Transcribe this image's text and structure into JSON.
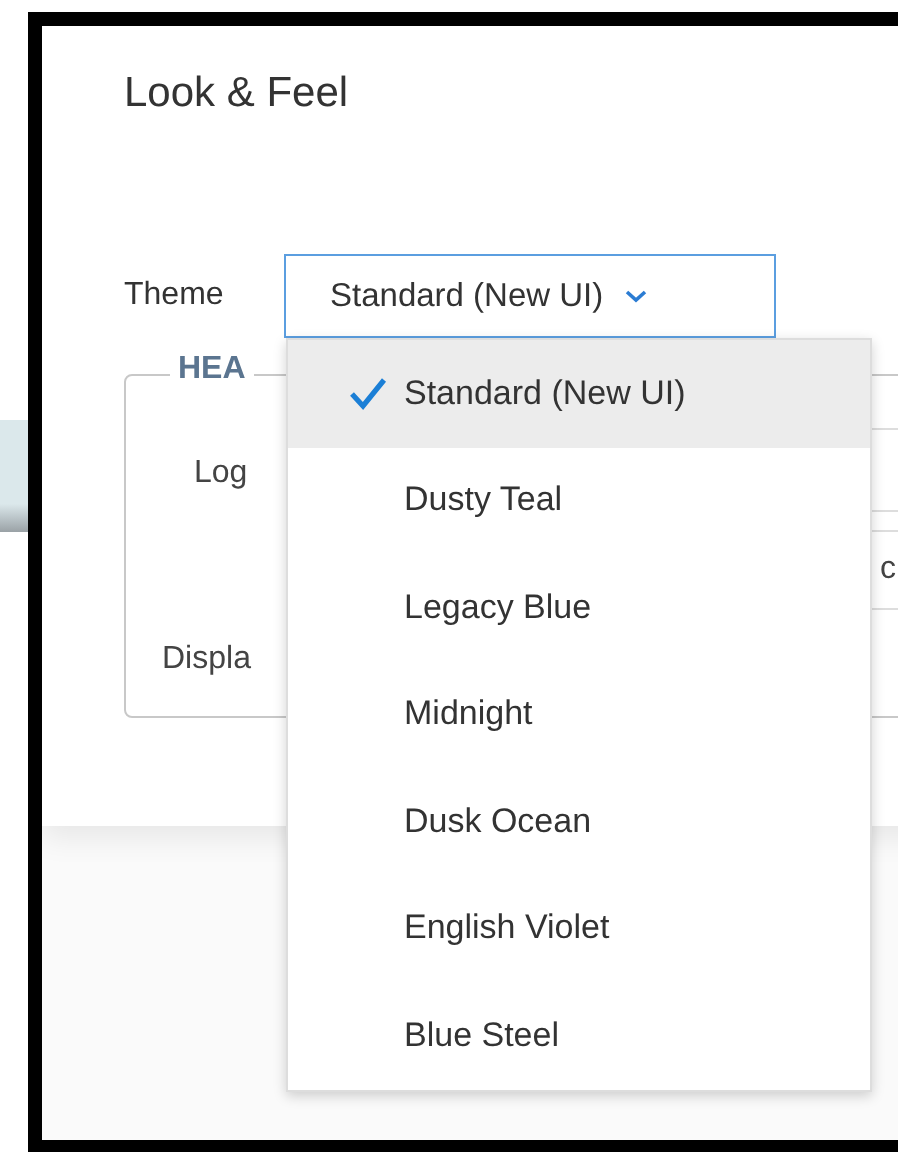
{
  "window": {
    "title": "Look & Feel"
  },
  "theme": {
    "label": "Theme",
    "value": "Standard (New UI)",
    "expanded": true,
    "options": [
      {
        "label": "Standard (New UI)",
        "selected": true
      },
      {
        "label": "Dusty Teal",
        "selected": false
      },
      {
        "label": "Legacy Blue",
        "selected": false
      },
      {
        "label": "Midnight",
        "selected": false
      },
      {
        "label": "Dusk Ocean",
        "selected": false
      },
      {
        "label": "English Violet",
        "selected": false
      },
      {
        "label": "Blue Steel",
        "selected": false
      }
    ]
  },
  "header_section": {
    "legend": "HEA",
    "logo_label": "Log",
    "field_text": "c",
    "display_label": "Displa"
  }
}
